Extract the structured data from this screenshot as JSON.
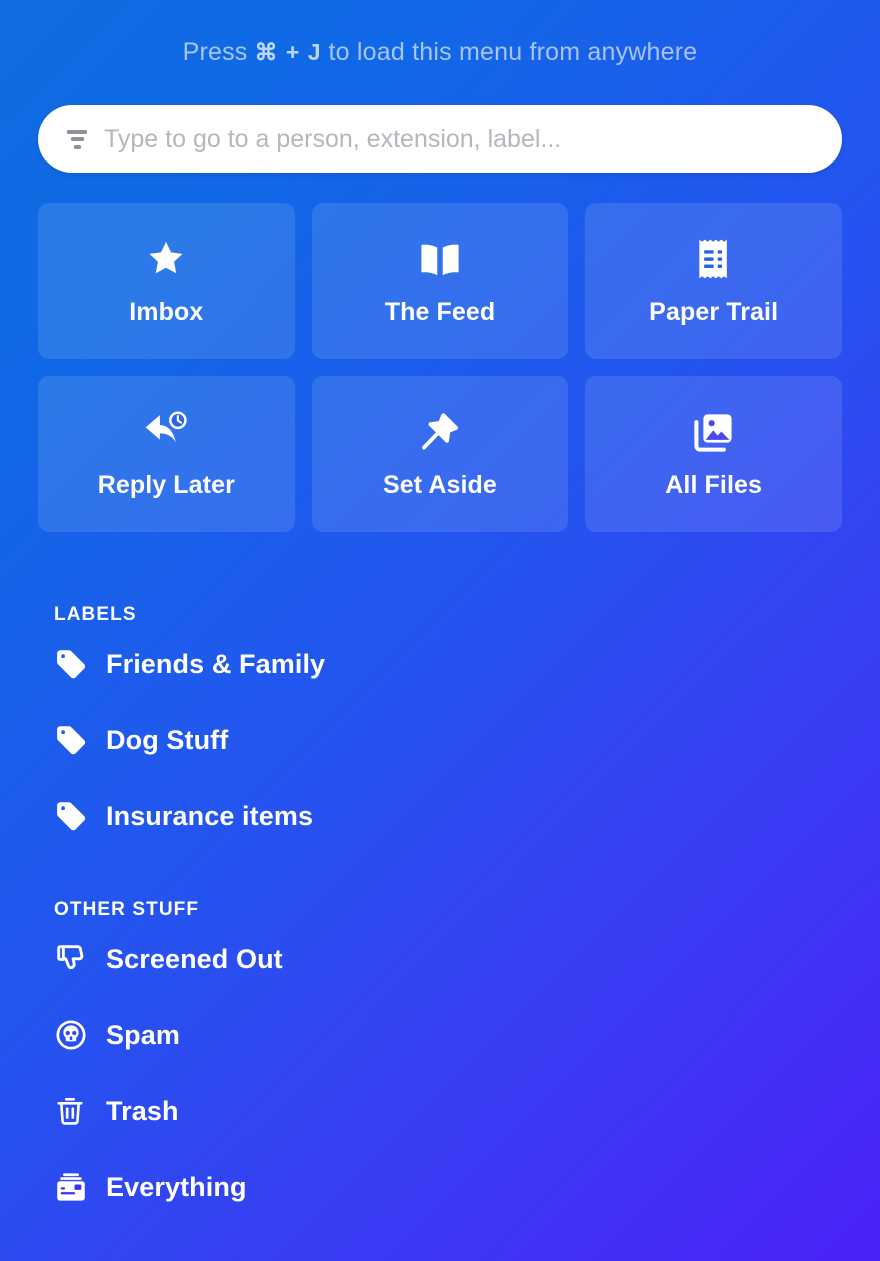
{
  "hint": {
    "prefix": "Press",
    "shortcut": "⌘ + J",
    "suffix": "to load this menu from anywhere"
  },
  "search": {
    "placeholder": "Type to go to a person, extension, label...",
    "value": "",
    "icon": "filter-icon"
  },
  "tiles": [
    {
      "label": "Imbox",
      "icon": "star-icon"
    },
    {
      "label": "The Feed",
      "icon": "open-book-icon"
    },
    {
      "label": "Paper Trail",
      "icon": "receipt-icon"
    },
    {
      "label": "Reply Later",
      "icon": "reply-clock-icon"
    },
    {
      "label": "Set Aside",
      "icon": "pushpin-icon"
    },
    {
      "label": "All Files",
      "icon": "photos-stack-icon"
    }
  ],
  "labels_section": {
    "heading": "LABELS",
    "items": [
      {
        "label": "Friends & Family",
        "icon": "tag-icon"
      },
      {
        "label": "Dog Stuff",
        "icon": "tag-icon"
      },
      {
        "label": "Insurance items",
        "icon": "tag-icon"
      }
    ]
  },
  "other_section": {
    "heading": "OTHER STUFF",
    "items": [
      {
        "label": "Screened Out",
        "icon": "thumbs-down-icon"
      },
      {
        "label": "Spam",
        "icon": "skull-circle-icon"
      },
      {
        "label": "Trash",
        "icon": "trash-icon"
      },
      {
        "label": "Everything",
        "icon": "archive-box-icon"
      }
    ]
  },
  "colors": {
    "gradient_start": "#0f6ce2",
    "gradient_end": "#4b21f6",
    "tile_overlay": "rgba(255,255,255,0.115)",
    "foreground": "#ffffff",
    "search_background": "#ffffff",
    "placeholder": "#b4b7bd"
  }
}
